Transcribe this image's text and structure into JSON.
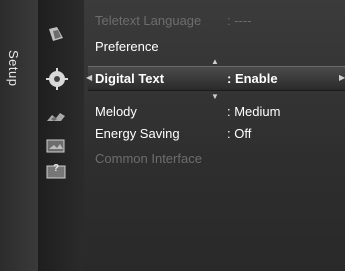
{
  "sidebar": {
    "title": "Setup",
    "icons": [
      {
        "name": "picture-icon"
      },
      {
        "name": "setup-gear-icon"
      },
      {
        "name": "sound-icon"
      },
      {
        "name": "input-icon"
      },
      {
        "name": "support-icon",
        "glyph": "?"
      }
    ]
  },
  "menu": {
    "items": [
      {
        "label": "Teletext Language",
        "value": ": ----",
        "state": "disabled"
      },
      {
        "label": "Preference",
        "value": "",
        "state": "normal"
      },
      {
        "label": "Digital Text",
        "value": ": Enable",
        "state": "selected"
      },
      {
        "label": "Melody",
        "value": ": Medium",
        "state": "normal"
      },
      {
        "label": "Energy Saving",
        "value": ": Off",
        "state": "normal"
      },
      {
        "label": "Common Interface",
        "value": "",
        "state": "disabled"
      }
    ]
  },
  "colors": {
    "background": "#2e2e2e",
    "text": "#ffffff",
    "disabled_text": "#6d6d6d"
  }
}
